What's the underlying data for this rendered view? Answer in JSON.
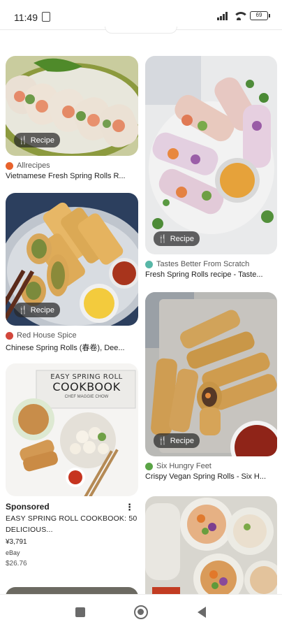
{
  "status_bar": {
    "time": "11:49",
    "battery": "69"
  },
  "pins": [
    {
      "source": "Allrecipes",
      "source_color": "#e8622c",
      "title": "Vietnamese Fresh Spring Rolls R...",
      "badge": "Recipe"
    },
    {
      "source": "Red House Spice",
      "source_color": "#d2473c",
      "title": "Chinese Spring Rolls (春卷), Dee...",
      "badge": "Recipe"
    },
    {
      "source": "Tastes Better From Scratch",
      "source_color": "#58b7a7",
      "title": "Fresh Spring Rolls recipe - Taste...",
      "badge": "Recipe"
    },
    {
      "source": "Six Hungry Feet",
      "source_color": "#5aa446",
      "title": "Crispy Vegan Spring Rolls - Six H...",
      "badge": "Recipe"
    }
  ],
  "ad": {
    "label": "Sponsored",
    "title": "EASY SPRING ROLL COOKBOOK: 50 DELICIOUS...",
    "price": "¥3,791",
    "store": "eBay",
    "original_price": "$26.76",
    "image_heading_1": "EASY SPRING ROLL",
    "image_heading_2": "COOKBOOK",
    "image_author": "CHEF MAGGIE CHOW"
  }
}
